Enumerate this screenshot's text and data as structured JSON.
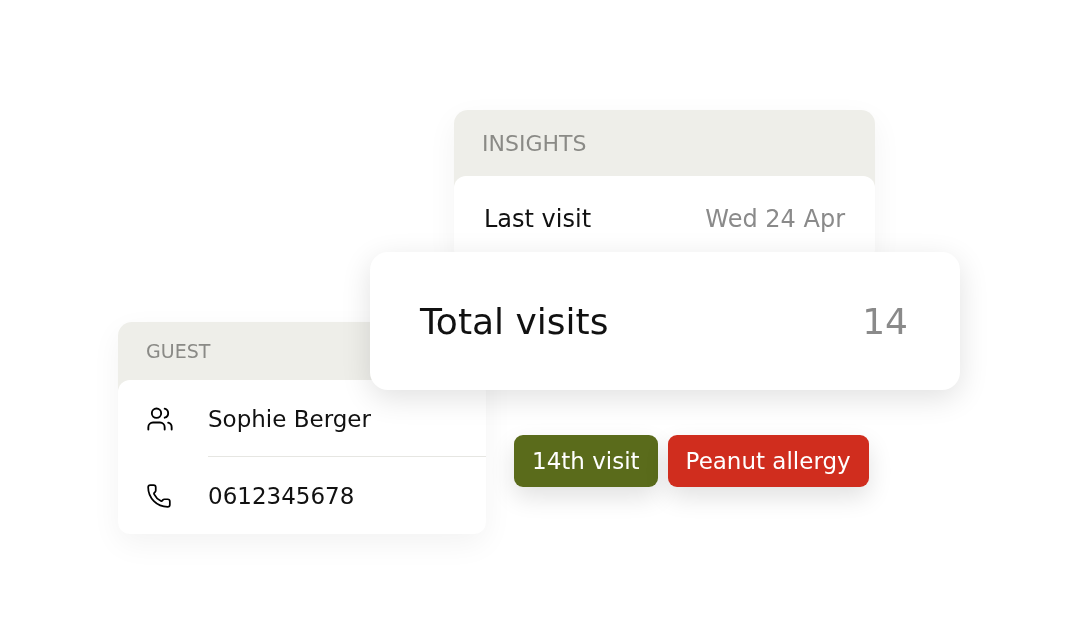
{
  "insights": {
    "title": "INSIGHTS",
    "rows": [
      {
        "label": "Last visit",
        "value": "Wed 24 Apr"
      }
    ]
  },
  "total_visits": {
    "label": "Total visits",
    "value": "14"
  },
  "guest": {
    "title": "GUEST",
    "rows": [
      {
        "kind": "person",
        "value": "Sophie Berger"
      },
      {
        "kind": "phone",
        "value": "0612345678"
      }
    ]
  },
  "tags": [
    {
      "label": "14th visit",
      "color": "#5a6b1b"
    },
    {
      "label": "Peanut allergy",
      "color": "#d02d1e"
    }
  ]
}
